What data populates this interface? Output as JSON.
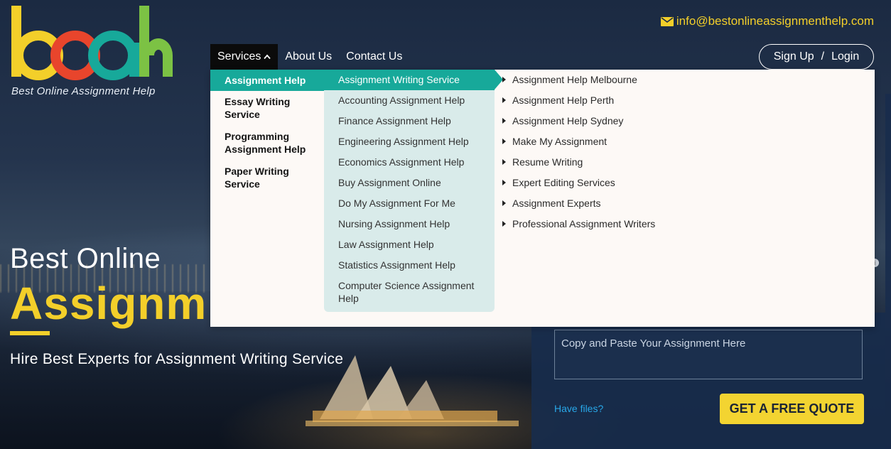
{
  "brand": {
    "tagline": "Best Online Assignment Help",
    "colors": {
      "accent_yellow": "#f3cf2a",
      "teal": "#17a99a",
      "quote_button": "#f3d431",
      "link_blue": "#28a7e8"
    }
  },
  "header": {
    "email": "info@bestonlineassignmenthelp.com",
    "email_icon": "envelope-icon"
  },
  "nav": {
    "items": [
      {
        "label": "Services",
        "icon": "chevron-up-icon",
        "active": true
      },
      {
        "label": "About Us"
      },
      {
        "label": "Contact Us"
      }
    ],
    "sign_up": "Sign Up",
    "separator": "/",
    "login": "Login"
  },
  "dropdown": {
    "categories": [
      {
        "label": "Assignment Help",
        "active": true
      },
      {
        "label": "Essay Writing Service"
      },
      {
        "label": "Programming Assignment Help"
      },
      {
        "label": "Paper Writing Service"
      }
    ],
    "subjects": [
      {
        "label": "Assignment Writing Service",
        "active": true
      },
      {
        "label": "Accounting Assignment Help"
      },
      {
        "label": "Finance Assignment Help"
      },
      {
        "label": "Engineering Assignment Help"
      },
      {
        "label": "Economics Assignment Help"
      },
      {
        "label": "Buy Assignment Online"
      },
      {
        "label": "Do My Assignment For Me"
      },
      {
        "label": "Nursing Assignment Help"
      },
      {
        "label": "Law Assignment Help"
      },
      {
        "label": "Statistics Assignment Help"
      },
      {
        "label": "Computer Science Assignment Help"
      }
    ],
    "links": [
      "Assignment Help Melbourne",
      "Assignment Help Perth",
      "Assignment Help Sydney",
      "Make My Assignment",
      "Resume Writing",
      "Expert Editing Services",
      "Assignment Experts",
      "Professional Assignment Writers"
    ]
  },
  "hero": {
    "line1": "Best Online",
    "line2": "Assignm",
    "subtitle": "Hire Best Experts for Assignment Writing Service"
  },
  "quote_form": {
    "textarea_placeholder": "Copy and Paste Your Assignment Here",
    "have_files": "Have files?",
    "button": "GET A FREE QUOTE"
  }
}
